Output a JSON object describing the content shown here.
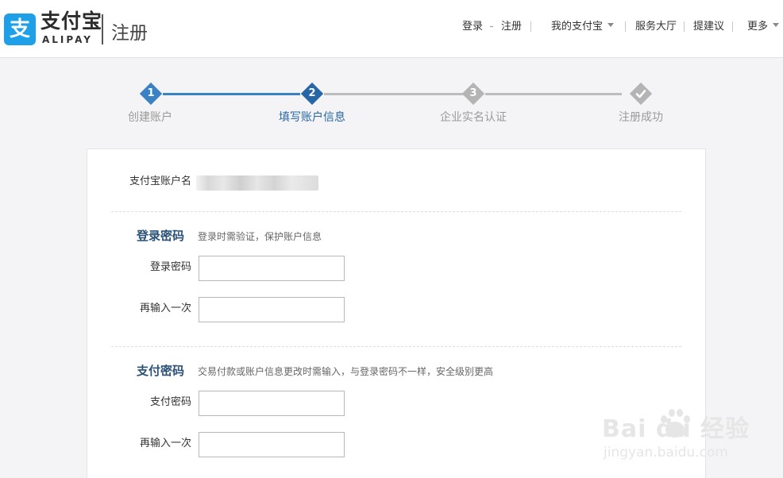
{
  "header": {
    "logo_icon_char": "支",
    "logo_cn": "支付宝",
    "logo_en": "ALIPAY",
    "page_name": "注册",
    "nav": {
      "login": "登录",
      "register": "注册",
      "my_alipay": "我的支付宝",
      "service_hall": "服务大厅",
      "suggestion": "提建议",
      "more": "更多"
    }
  },
  "progress": {
    "current_step": 2,
    "steps": [
      {
        "num": "1",
        "label": "创建账户",
        "status": "done"
      },
      {
        "num": "2",
        "label": "填写账户信息",
        "status": "current"
      },
      {
        "num": "3",
        "label": "企业实名认证",
        "status": "todo"
      },
      {
        "num": "",
        "label": "注册成功",
        "status": "todo"
      }
    ]
  },
  "form": {
    "account_label": "支付宝账户名",
    "login_section": {
      "title": "登录密码",
      "desc": "登录时需验证，保护账户信息",
      "password_label": "登录密码",
      "password_value": "",
      "confirm_label": "再输入一次",
      "confirm_value": ""
    },
    "pay_section": {
      "title": "支付密码",
      "desc": "交易付款或账户信息更改时需输入，与登录密码不一样，安全级别更高",
      "password_label": "支付密码",
      "password_value": "",
      "confirm_label": "再输入一次",
      "confirm_value": ""
    }
  },
  "watermark": {
    "brand": "Bai  du 经验",
    "url": "jingyan.baidu.com"
  },
  "colors": {
    "brand_blue": "#1ea0e8",
    "step_done": "#3a82c4",
    "step_current": "#2767a7",
    "step_todo": "#b4b4b4",
    "section_title": "#2a5277"
  }
}
